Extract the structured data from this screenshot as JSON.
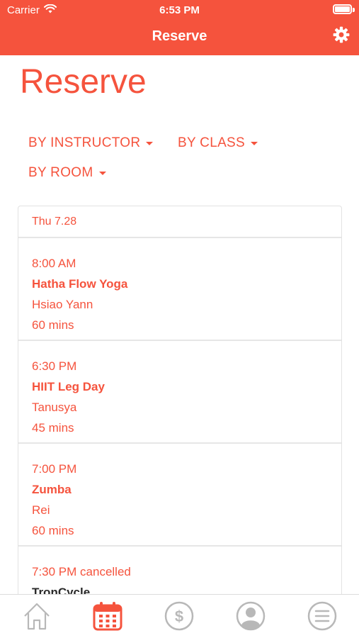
{
  "status_bar": {
    "carrier": "Carrier",
    "time": "6:53 PM"
  },
  "nav": {
    "title": "Reserve",
    "settings_icon": "gear-icon"
  },
  "page": {
    "title": "Reserve"
  },
  "filters": [
    {
      "label": "BY INSTRUCTOR"
    },
    {
      "label": "BY CLASS"
    },
    {
      "label": "BY ROOM"
    }
  ],
  "schedule": {
    "date": "Thu 7.28",
    "sessions": [
      {
        "time": "8:00 AM",
        "class_name": "Hatha Flow Yoga",
        "instructor": "Hsiao Yann",
        "duration": "60 mins",
        "cancelled": false
      },
      {
        "time": "6:30 PM",
        "class_name": "HIIT Leg Day",
        "instructor": "Tanusya",
        "duration": "45 mins",
        "cancelled": false
      },
      {
        "time": "7:00 PM",
        "class_name": "Zumba",
        "instructor": "Rei",
        "duration": "60 mins",
        "cancelled": false
      },
      {
        "time": "7:30 PM cancelled",
        "class_name": "TronCycle",
        "instructor": "",
        "duration": "",
        "cancelled": true
      }
    ]
  },
  "tab_bar": {
    "tabs": [
      {
        "icon": "home-icon",
        "active": false
      },
      {
        "icon": "calendar-icon",
        "active": true
      },
      {
        "icon": "dollar-icon",
        "active": false
      },
      {
        "icon": "profile-icon",
        "active": false
      },
      {
        "icon": "menu-icon",
        "active": false
      }
    ]
  },
  "colors": {
    "accent": "#f5533d",
    "inactive_icon": "#b8b8b8",
    "text_dark": "#2a2a2a",
    "divider": "#e6e6e6"
  }
}
